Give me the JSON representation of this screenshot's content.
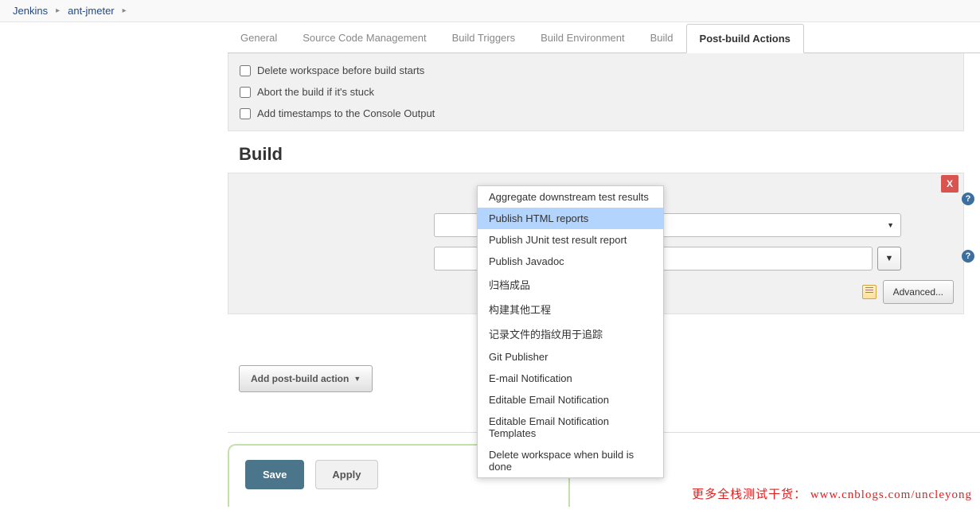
{
  "breadcrumb": {
    "root": "Jenkins",
    "project": "ant-jmeter"
  },
  "tabs": {
    "general": "General",
    "scm": "Source Code Management",
    "triggers": "Build Triggers",
    "env": "Build Environment",
    "build": "Build",
    "post": "Post-build Actions"
  },
  "env_checks": {
    "delete_ws": "Delete workspace before build starts",
    "abort_stuck": "Abort the build if it's stuck",
    "timestamps": "Add timestamps to the Console Output"
  },
  "build_section": {
    "title": "Build"
  },
  "close_label": "X",
  "dd_triangle": "▼",
  "advanced_label": "Advanced...",
  "add_post_action": "Add post-build action",
  "save_label": "Save",
  "apply_label": "Apply",
  "menu": {
    "m0": "Aggregate downstream test results",
    "m1": "Publish HTML reports",
    "m2": "Publish JUnit test result report",
    "m3": "Publish Javadoc",
    "m4": "归档成品",
    "m5": "构建其他工程",
    "m6": "记录文件的指纹用于追踪",
    "m7": "Git Publisher",
    "m8": "E-mail Notification",
    "m9": "Editable Email Notification",
    "m10": "Editable Email Notification Templates",
    "m11": "Delete workspace when build is done"
  },
  "footer": "更多全栈测试干货： www.cnblogs.com/uncleyong"
}
